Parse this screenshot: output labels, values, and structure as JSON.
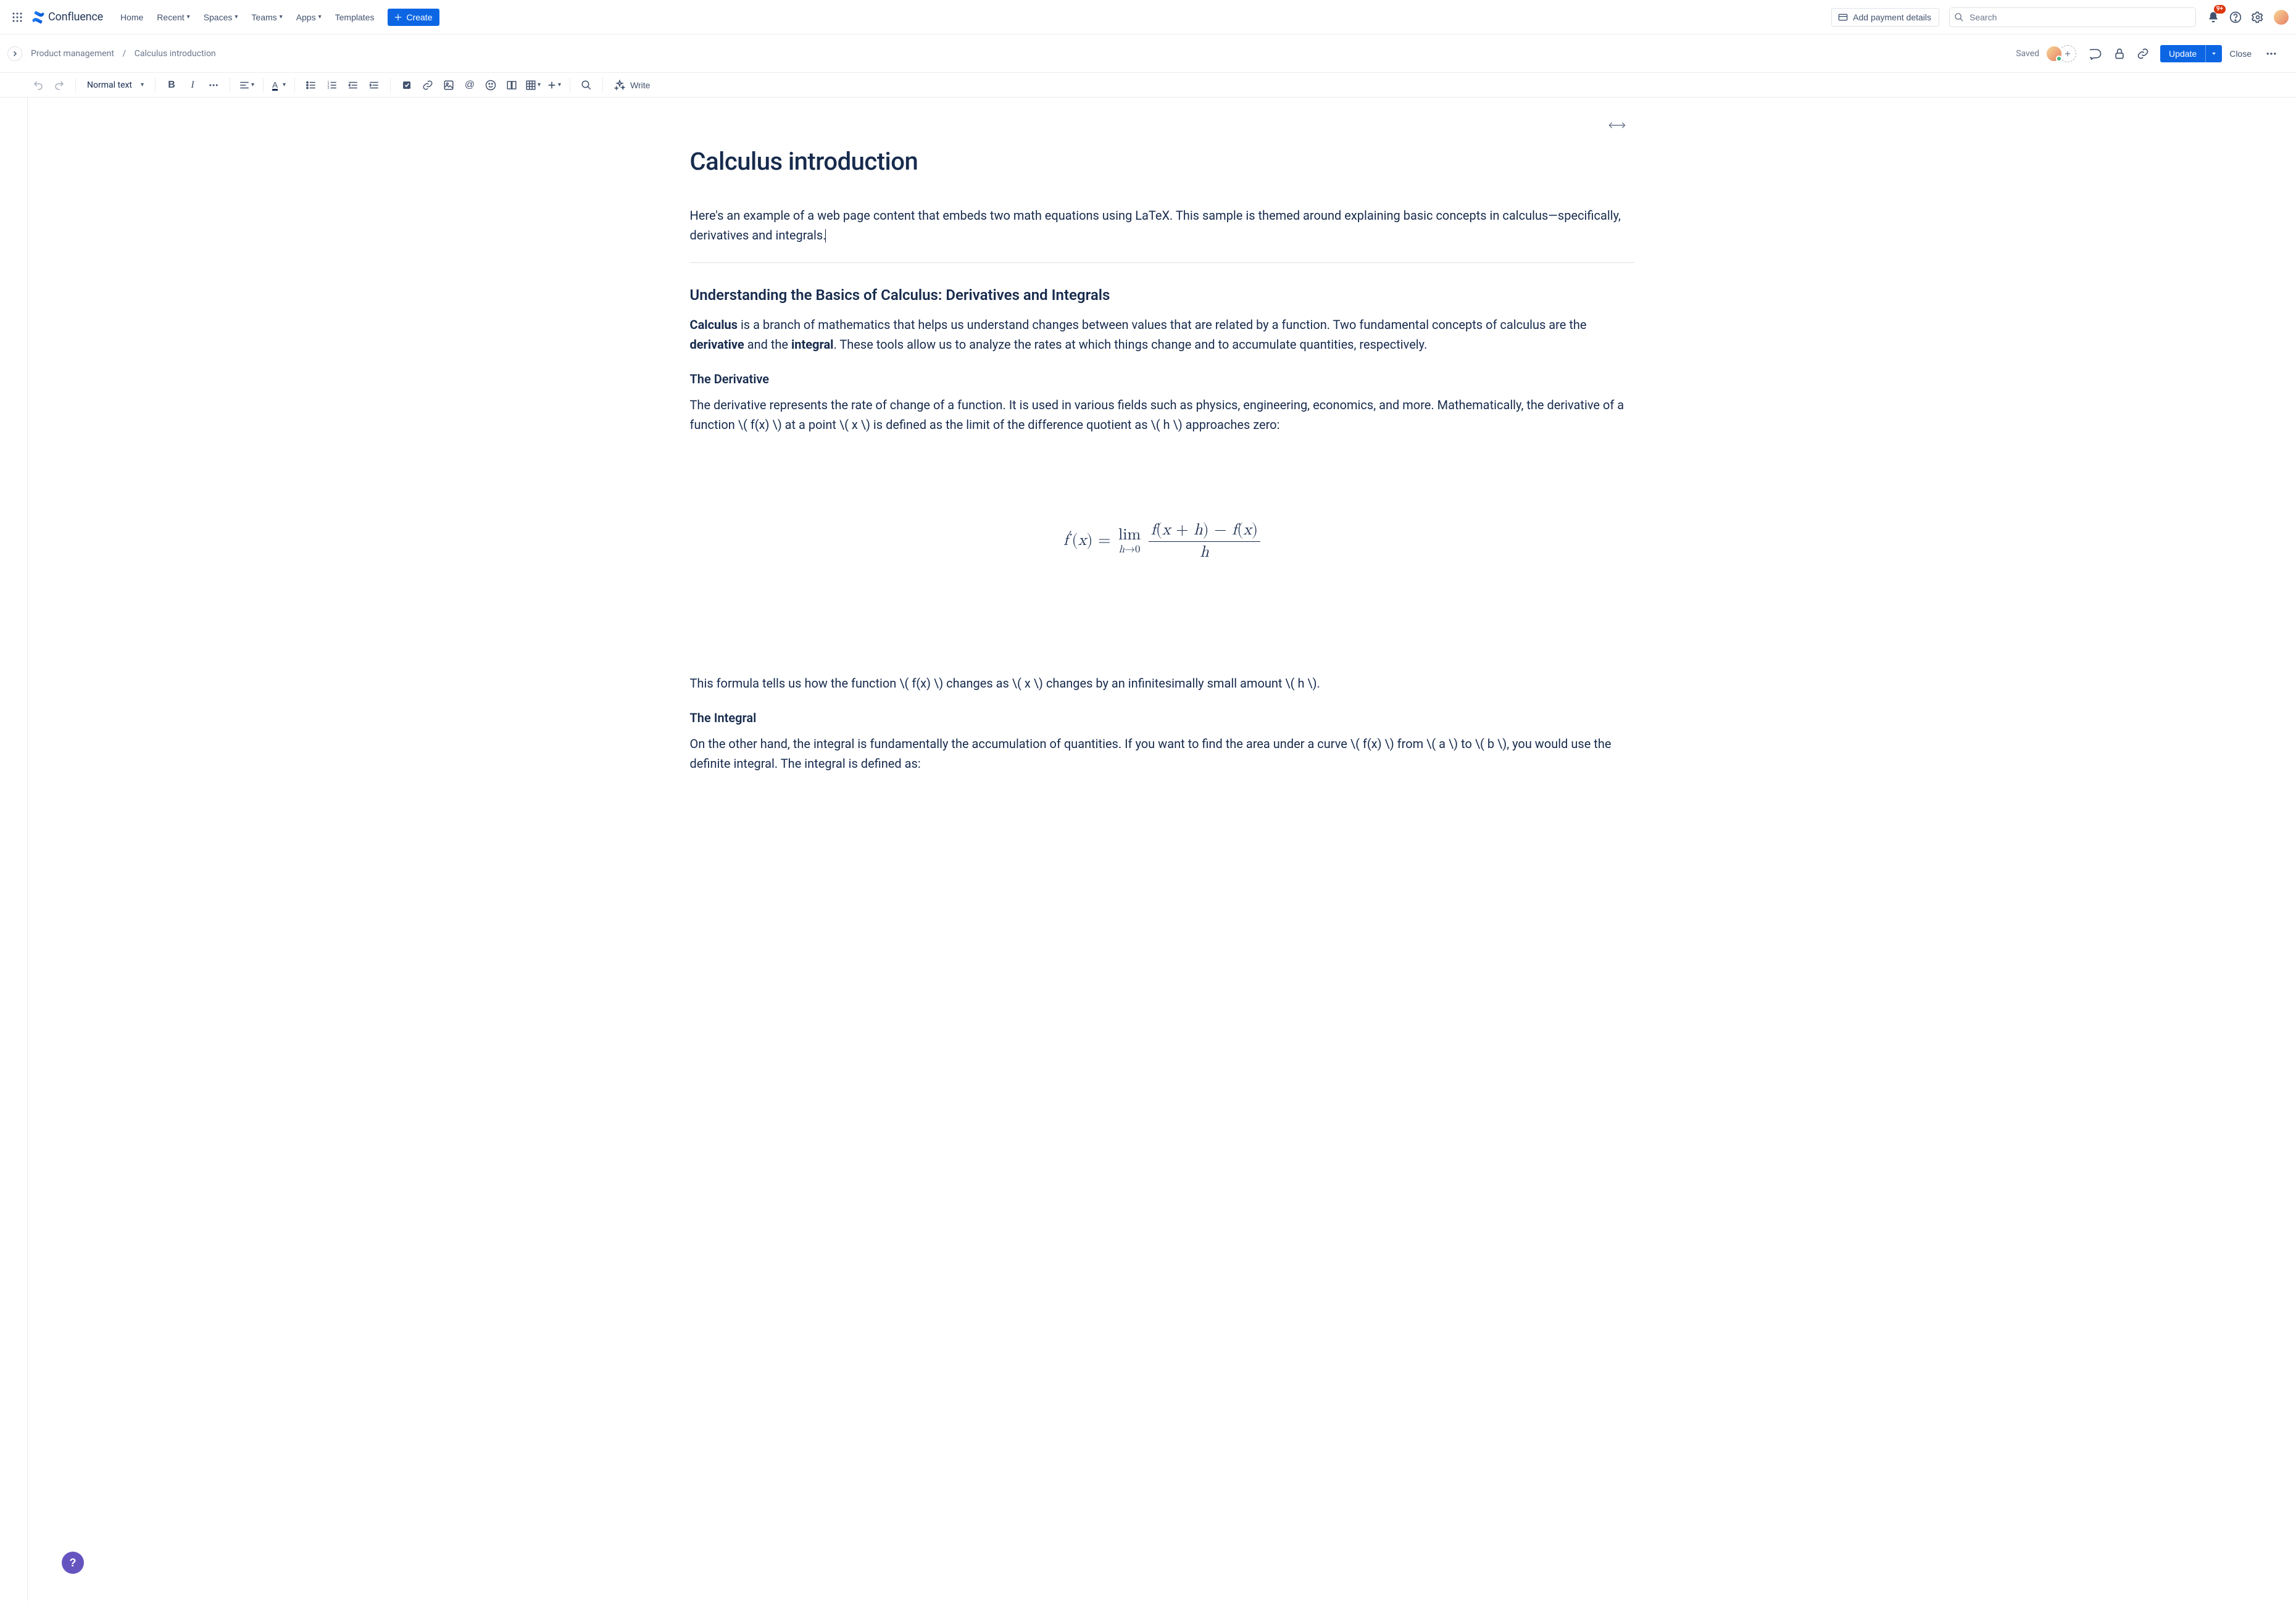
{
  "brand": "Confluence",
  "nav": {
    "home": "Home",
    "recent": "Recent",
    "spaces": "Spaces",
    "teams": "Teams",
    "apps": "Apps",
    "templates": "Templates",
    "create": "Create"
  },
  "payment_label": "Add payment details",
  "search_placeholder": "Search",
  "notif_count": "9+",
  "breadcrumb": {
    "space": "Product management",
    "page": "Calculus introduction"
  },
  "status": "Saved",
  "actions": {
    "update": "Update",
    "close": "Close"
  },
  "toolbar": {
    "text_style": "Normal text",
    "write": "Write"
  },
  "doc": {
    "title": "Calculus introduction",
    "intro": "Here's an example of a web page content that embeds two math equations using LaTeX. This sample is themed around explaining basic concepts in calculus—specifically, derivatives and integrals.",
    "h2": "Understanding the Basics of Calculus: Derivatives and Integrals",
    "p1_a": "Calculus",
    "p1_b": " is a branch of mathematics that helps us understand changes between values that are related by a function. Two fundamental concepts of calculus are the ",
    "p1_c": "derivative",
    "p1_d": " and the ",
    "p1_e": "integral",
    "p1_f": ". These tools allow us to analyze the rates at which things change and to accumulate quantities, respectively.",
    "h3_deriv": "The Derivative",
    "p2": "The derivative represents the rate of change of a function. It is used in various fields such as physics, engineering, economics, and more. Mathematically, the derivative of a function \\( f(x) \\) at a point \\( x \\) is defined as the limit of the difference quotient as \\( h \\) approaches zero:",
    "eq1_latex": "f'(x) = \\lim_{h \\to 0} \\frac{f(x+h) - f(x)}{h}",
    "p3": "This formula tells us how the function \\( f(x) \\) changes as \\( x \\) changes by an infinitesimally small amount \\( h \\).",
    "h3_int": "The Integral",
    "p4": "On the other hand, the integral is fundamentally the accumulation of quantities. If you want to find the area under a curve \\( f(x) \\) from \\( a \\) to \\( b \\), you would use the definite integral. The integral is defined as:"
  }
}
